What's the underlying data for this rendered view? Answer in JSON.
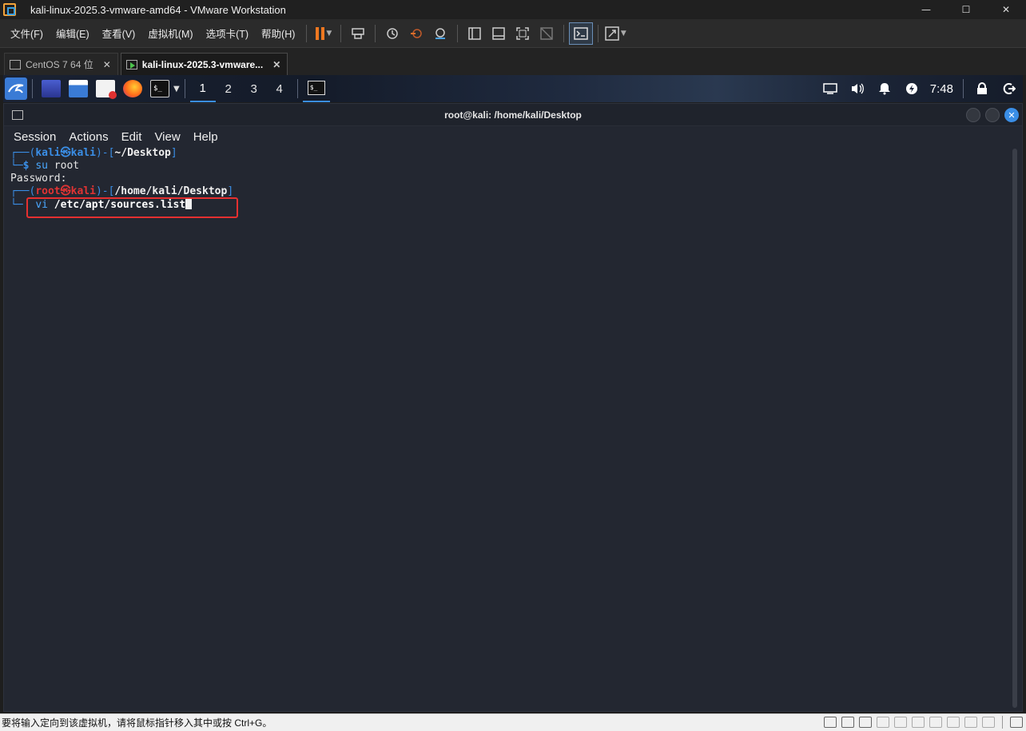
{
  "window": {
    "title": "kali-linux-2025.3-vmware-amd64 - VMware Workstation",
    "controls": {
      "minimize": "—",
      "maximize": "☐",
      "close": "✕"
    }
  },
  "menu": {
    "file": "文件(F)",
    "edit": "编辑(E)",
    "view": "查看(V)",
    "vm": "虚拟机(M)",
    "tabs": "选项卡(T)",
    "help": "帮助(H)"
  },
  "toolbar": {
    "icons": [
      "pause-icon",
      "send-keys-icon",
      "snapshot-icon",
      "revert-snapshot-icon",
      "snapshot-manager-icon",
      "library-icon",
      "thumbnail-icon",
      "fullscreen-icon",
      "unity-icon",
      "console-icon",
      "stretch-icon"
    ]
  },
  "vm_tabs": [
    {
      "label": "CentOS 7 64 位",
      "active": false
    },
    {
      "label": "kali-linux-2025.3-vmware...",
      "active": true
    }
  ],
  "kali_panel": {
    "workspaces": [
      "1",
      "2",
      "3",
      "4"
    ],
    "active_workspace": "1",
    "terminal_glyph": "$_",
    "time": "7:48"
  },
  "terminal": {
    "title": "root@kali: /home/kali/Desktop",
    "menu": [
      "Session",
      "Actions",
      "Edit",
      "View",
      "Help"
    ],
    "lines": {
      "l1_prefix": "┌──(",
      "l1_user": "kali㉿kali",
      "l1_mid": ")-[",
      "l1_dir": "~/Desktop",
      "l1_end": "]",
      "l2_prefix": "└─",
      "l2_prompt": "$",
      "l2_cmd": "su",
      "l2_arg": "root",
      "l3": "Password:",
      "l4_prefix": "┌──(",
      "l4_user": "root㉿kali",
      "l4_mid": ")-[",
      "l4_dir": "/home/kali/Desktop",
      "l4_end": "]",
      "l5_prefix": "└─",
      "l5_cmd": "vi",
      "l5_arg": "/etc/apt/sources.list"
    }
  },
  "statusbar": {
    "message": "要将输入定向到该虚拟机，请将鼠标指针移入其中或按 Ctrl+G。"
  },
  "colors": {
    "accent": "#3a8ee6",
    "highlight_box": "#e53030",
    "terminal_bg": "#232731",
    "pause_orange": "#f07820"
  }
}
